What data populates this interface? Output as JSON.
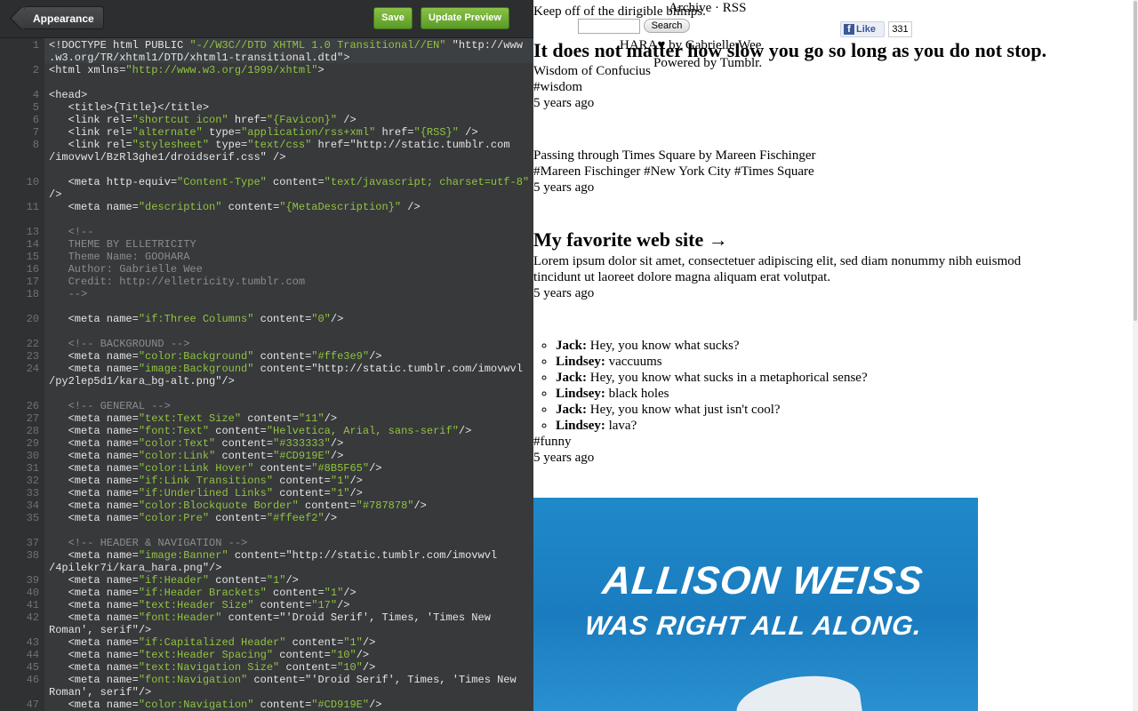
{
  "editor": {
    "toolbar": {
      "back_label": "Appearance",
      "save_label": "Save",
      "preview_label": "Update Preview"
    },
    "line_numbers": [
      "1",
      "",
      "2",
      "",
      "4",
      "5",
      "6",
      "7",
      "8",
      "",
      "",
      "10",
      "",
      "11",
      "",
      "13",
      "14",
      "15",
      "16",
      "17",
      "18",
      "",
      "20",
      "",
      "22",
      "23",
      "24",
      "",
      "",
      "26",
      "27",
      "28",
      "29",
      "30",
      "31",
      "32",
      "33",
      "34",
      "35",
      "",
      "37",
      "38",
      "",
      "39",
      "40",
      "41",
      "42",
      "",
      "43",
      "44",
      "45",
      "46",
      "",
      "47"
    ],
    "lines": [
      "<!DOCTYPE html PUBLIC \"-//W3C//DTD XHTML 1.0 Transitional//EN\" \"http://www",
      ".w3.org/TR/xhtml1/DTD/xhtml1-transitional.dtd\">",
      "<html xmlns=\"http://www.w3.org/1999/xhtml\">",
      "",
      "<head>",
      "   <title>{Title}</title>",
      "   <link rel=\"shortcut icon\" href=\"{Favicon}\" />",
      "   <link rel=\"alternate\" type=\"application/rss+xml\" href=\"{RSS}\" />",
      "   <link rel=\"stylesheet\" type=\"text/css\" href=\"http://static.tumblr.com",
      "/imovwvl/BzRl3ghe1/droidserif.css\" />",
      "",
      "   <meta http-equiv=\"Content-Type\" content=\"text/javascript; charset=utf-8\"",
      "/>",
      "   <meta name=\"description\" content=\"{MetaDescription}\" />",
      "",
      "   <!--",
      "   THEME BY ELLETRICITY",
      "   Theme Name: GOOHARA",
      "   Author: Gabrielle Wee",
      "   Credit: http://elletricity.tumblr.com",
      "   -->",
      "",
      "   <meta name=\"if:Three Columns\" content=\"0\"/>",
      "",
      "   <!-- BACKGROUND -->",
      "   <meta name=\"color:Background\" content=\"#ffe3e9\"/>",
      "   <meta name=\"image:Background\" content=\"http://static.tumblr.com/imovwvl",
      "/py2lep5d1/kara_bg-alt.png\"/>",
      "",
      "   <!-- GENERAL -->",
      "   <meta name=\"text:Text Size\" content=\"11\"/>",
      "   <meta name=\"font:Text\" content=\"Helvetica, Arial, sans-serif\"/>",
      "   <meta name=\"color:Text\" content=\"#333333\"/>",
      "   <meta name=\"color:Link\" content=\"#CD919E\"/>",
      "   <meta name=\"color:Link Hover\" content=\"#8B5F65\"/>",
      "   <meta name=\"if:Link Transitions\" content=\"1\"/>",
      "   <meta name=\"if:Underlined Links\" content=\"1\"/>",
      "   <meta name=\"color:Blockquote Border\" content=\"#787878\"/>",
      "   <meta name=\"color:Pre\" content=\"#ffeef2\"/>",
      "",
      "   <!-- HEADER & NAVIGATION -->",
      "   <meta name=\"image:Banner\" content=\"http://static.tumblr.com/imovwvl",
      "/4pilekr7i/kara_hara.png\"/>",
      "   <meta name=\"if:Header\" content=\"1\"/>",
      "   <meta name=\"if:Header Brackets\" content=\"1\"/>",
      "   <meta name=\"text:Header Size\" content=\"17\"/>",
      "   <meta name=\"font:Header\" content=\"'Droid Serif', Times, 'Times New",
      "Roman', serif\"/>",
      "   <meta name=\"if:Capitalized Header\" content=\"1\"/>",
      "   <meta name=\"text:Header Spacing\" content=\"10\"/>",
      "   <meta name=\"text:Navigation Size\" content=\"10\"/>",
      "   <meta name=\"font:Navigation\" content=\"'Droid Serif', Times, 'Times New",
      "Roman', serif\"/>",
      "   <meta name=\"color:Navigation\" content=\"#CD919E\"/>"
    ]
  },
  "preview": {
    "top_text_1": "Keep off of the dirigible blimps.",
    "nav": "Archive · RSS",
    "search_button": "Search",
    "fb_like": "Like",
    "fb_count": "331",
    "credit": "HARA♥ by Gabrielle Wee",
    "powered": "Powered by Tumblr.",
    "post1": {
      "title": "It does not matter how slow you go so long as you do not stop.",
      "source": "Wisdom of Confucius",
      "tag": "#wisdom",
      "time": "5 years ago"
    },
    "post2": {
      "caption": "Passing through Times Square by Mareen Fischinger",
      "tags": "#Mareen Fischinger   #New York City   #Times Square",
      "time": "5 years ago"
    },
    "post3": {
      "title": "My favorite web site →",
      "body_1": "Lorem ipsum dolor sit amet, consectetuer adipiscing elit, sed diam nonummy nibh euismod",
      "body_2": "tincidunt ut laoreet dolore magna aliquam erat volutpat.",
      "time": "5 years ago"
    },
    "post4": {
      "chat": [
        {
          "speaker": "Jack:",
          "line": " Hey, you know what sucks?"
        },
        {
          "speaker": "Lindsey:",
          "line": " vaccuums"
        },
        {
          "speaker": "Jack:",
          "line": " Hey, you know what sucks in a metaphorical sense?"
        },
        {
          "speaker": "Lindsey:",
          "line": " black holes"
        },
        {
          "speaker": "Jack:",
          "line": " Hey, you know what just isn't cool?"
        },
        {
          "speaker": "Lindsey:",
          "line": " lava?"
        }
      ],
      "tag": "#funny",
      "time": "5 years ago"
    },
    "post5": {
      "image_line1": "ALLISON WEISS",
      "image_line2": "WAS RIGHT ALL ALONG."
    }
  }
}
